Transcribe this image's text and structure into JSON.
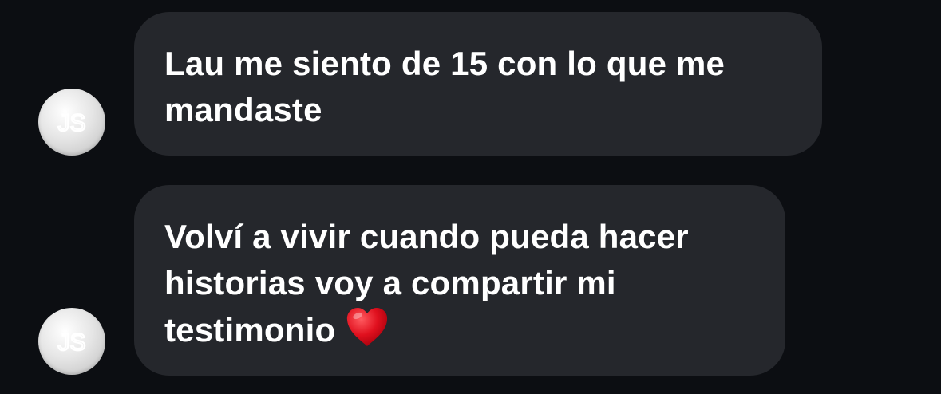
{
  "messages": [
    {
      "avatar_initials": "JS",
      "text": "Lau me siento de 15 con lo que me mandaste"
    },
    {
      "avatar_initials": "JS",
      "text": "Volví a vivir cuando pueda hacer historias voy a compartir mi testimonio",
      "emoji": "heart-icon"
    }
  ],
  "colors": {
    "background": "#0c0e12",
    "bubble": "#25272c",
    "text": "#ffffff",
    "heart": "#e0101e"
  }
}
